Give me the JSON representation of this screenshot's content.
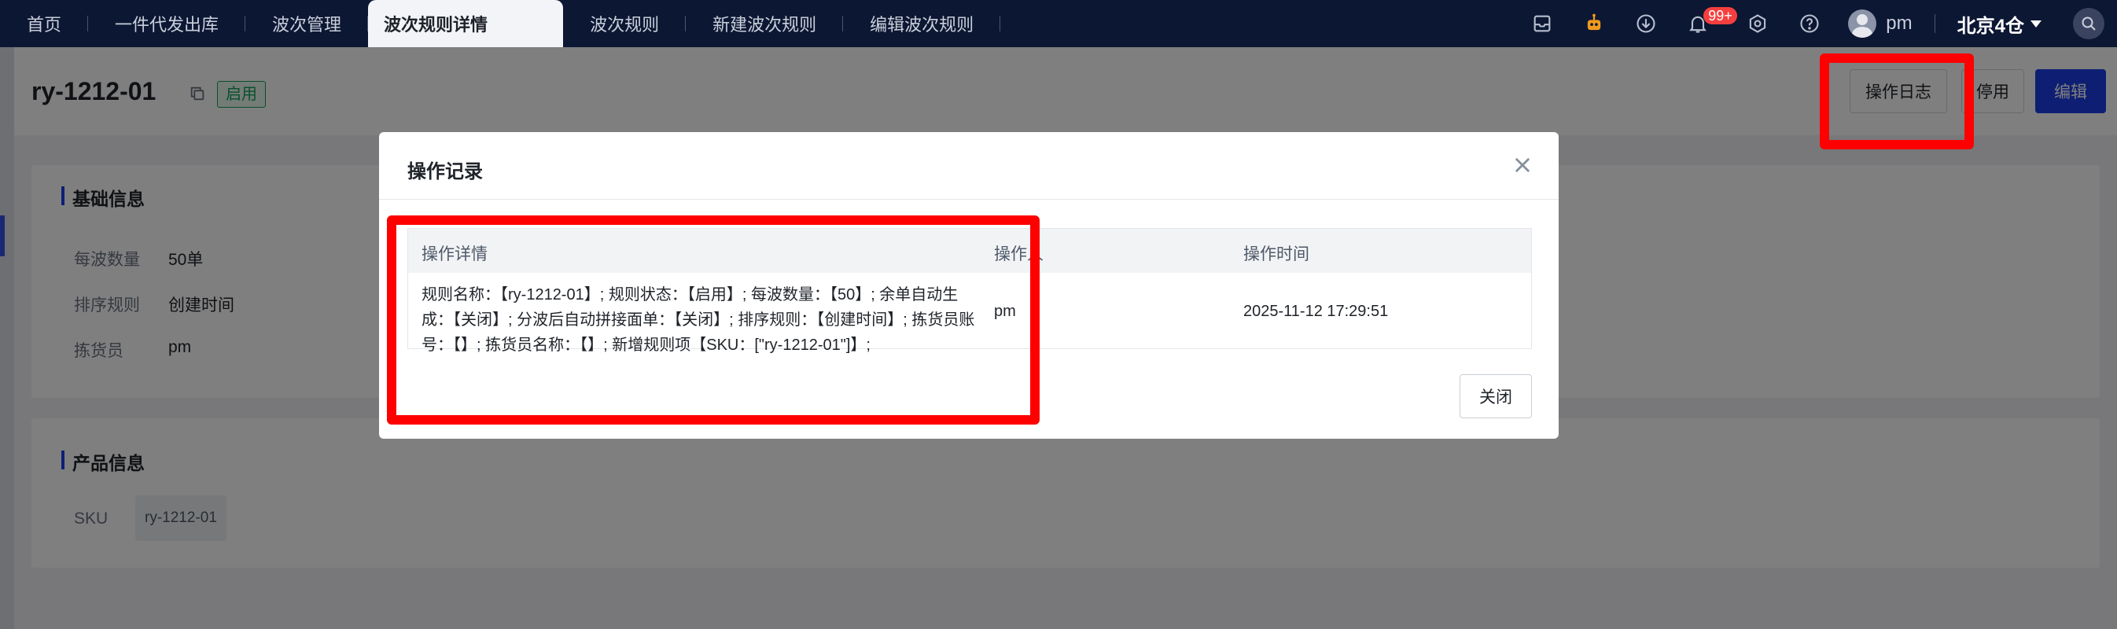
{
  "tabs": [
    {
      "label": "首页",
      "active": false
    },
    {
      "label": "一件代发出库",
      "active": false
    },
    {
      "label": "波次管理",
      "active": false
    },
    {
      "label": "波次规则详情",
      "active": true
    },
    {
      "label": "波次规则",
      "active": false
    },
    {
      "label": "新建波次规则",
      "active": false
    },
    {
      "label": "编辑波次规则",
      "active": false
    }
  ],
  "topbar": {
    "icons": [
      "inbox-icon",
      "robot-icon",
      "download-icon",
      "bell-icon",
      "settings-icon",
      "help-icon"
    ],
    "notification_badge": "99+",
    "user_name": "pm",
    "warehouse": "北京4仓",
    "search_icon": "search-icon"
  },
  "page": {
    "title": "ry-1212-01",
    "status": "启用",
    "buttons": {
      "log": "操作日志",
      "disable": "停用",
      "edit": "编辑"
    }
  },
  "basic": {
    "title": "基础信息",
    "fields": [
      {
        "label": "每波数量",
        "value": "50单"
      },
      {
        "label": "排序规则",
        "value": "创建时间"
      },
      {
        "label": "拣货员",
        "value": "pm"
      }
    ]
  },
  "product": {
    "title": "产品信息",
    "sku_label": "SKU",
    "sku_value": "ry-1212-01"
  },
  "modal": {
    "title": "操作记录",
    "columns": [
      "操作详情",
      "操作人",
      "操作时间"
    ],
    "rows": [
      {
        "detail": "规则名称：【ry-1212-01】; 规则状态：【启用】; 每波数量：【50】; 余单自动生成：【关闭】; 分波后自动拼接面单：【关闭】; 排序规则：【创建时间】; 拣货员账号：【】; 拣货员名称：【】; 新增规则项【SKU：[\"ry-1212-01\"]】;",
        "operator": "pm",
        "time": "2025-11-12 17:29:51"
      }
    ],
    "close_button": "关闭"
  },
  "colors": {
    "topbar": "#0c1733",
    "primary": "#1c3fe6",
    "success": "#13a15a",
    "highlight": "#ff0000"
  }
}
